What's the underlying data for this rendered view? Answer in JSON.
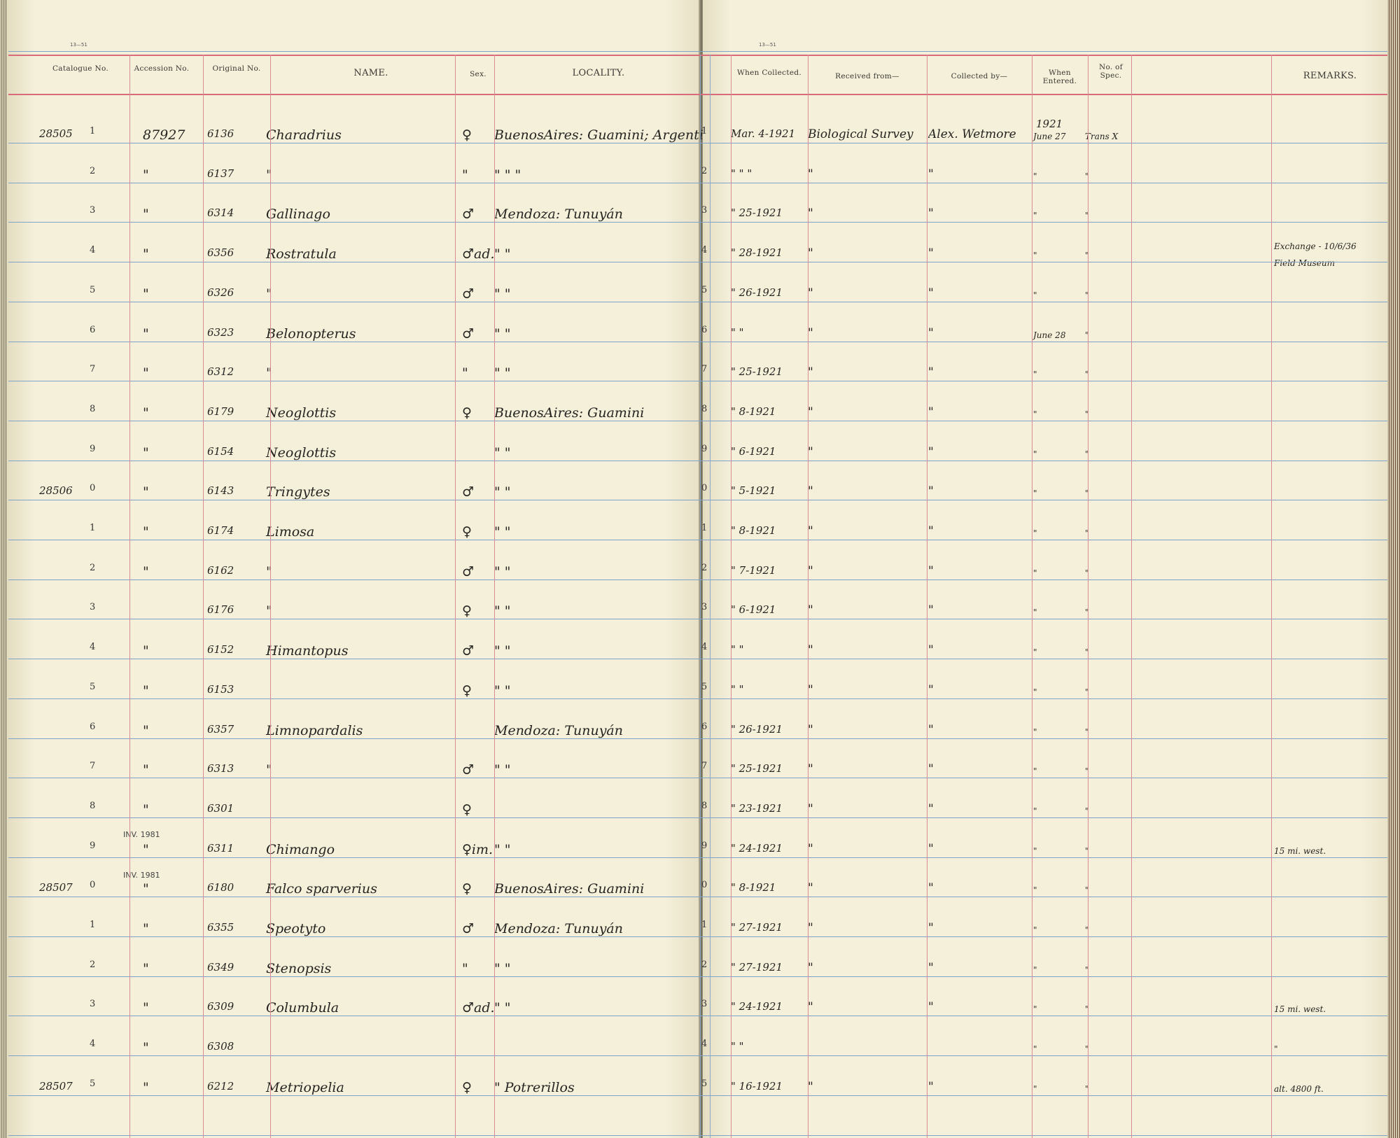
{
  "form_number": "13—51",
  "headers": {
    "catalogue_no": "Catalogue No.",
    "accession_no": "Accession No.",
    "original_no": "Original No.",
    "name": "NAME.",
    "sex": "Sex.",
    "locality": "LOCALITY.",
    "when_collected": "When Collected.",
    "received_from": "Received from—",
    "collected_by": "Collected by—",
    "when_entered": "When Entered.",
    "no_of_spec": "No. of Spec.",
    "remarks": "REMARKS."
  },
  "year_entered": "1921",
  "rows": [
    {
      "cat": "28505",
      "idx": "1",
      "acc": "87927",
      "orig": "6136",
      "name": "Charadrius",
      "sex": "♀",
      "loc": "BuenosAires: Guamini; Argentina",
      "when": "Mar. 4-1921",
      "recv": "Biological Survey",
      "coll": "Alex. Wetmore",
      "entered": "June 27",
      "spec": "Trans X",
      "remarks": ""
    },
    {
      "cat": "",
      "idx": "2",
      "acc": "\"",
      "orig": "6137",
      "name": "\"",
      "sex": "\"",
      "loc": "\"        \"        \"",
      "when": "\"   \"   \"",
      "recv": "\"",
      "coll": "\"",
      "entered": "\"",
      "spec": "\"",
      "remarks": ""
    },
    {
      "cat": "",
      "idx": "3",
      "acc": "\"",
      "orig": "6314",
      "name": "Gallinago",
      "sex": "♂",
      "loc": "Mendoza: Tunuyán",
      "when": "\" 25-1921",
      "recv": "\"",
      "coll": "\"",
      "entered": "\"",
      "spec": "\"",
      "remarks": ""
    },
    {
      "cat": "",
      "idx": "4",
      "acc": "\"",
      "orig": "6356",
      "name": "Rostratula",
      "sex": "♂ad.",
      "loc": "\"        \"",
      "when": "\" 28-1921",
      "recv": "\"",
      "coll": "\"",
      "entered": "\"",
      "spec": "\"",
      "remarks": "Exchange - 10/6/36 Field Museum"
    },
    {
      "cat": "",
      "idx": "5",
      "acc": "\"",
      "orig": "6326",
      "name": "\"",
      "sex": "♂",
      "loc": "\"        \"",
      "when": "\" 26-1921",
      "recv": "\"",
      "coll": "\"",
      "entered": "\"",
      "spec": "\"",
      "remarks": ""
    },
    {
      "cat": "",
      "idx": "6",
      "acc": "\"",
      "orig": "6323",
      "name": "Belonopterus",
      "sex": "♂",
      "loc": "\"        \"",
      "when": "\"   \"",
      "recv": "\"",
      "coll": "\"",
      "entered": "June 28",
      "spec": "\"",
      "remarks": ""
    },
    {
      "cat": "",
      "idx": "7",
      "acc": "\"",
      "orig": "6312",
      "name": "\"",
      "sex": "\"",
      "loc": "\"        \"",
      "when": "\" 25-1921",
      "recv": "\"",
      "coll": "\"",
      "entered": "\"",
      "spec": "\"",
      "remarks": ""
    },
    {
      "cat": "",
      "idx": "8",
      "acc": "\"",
      "orig": "6179",
      "name": "Neoglottis",
      "sex": "♀",
      "loc": "BuenosAires: Guamini",
      "when": "\" 8-1921",
      "recv": "\"",
      "coll": "\"",
      "entered": "\"",
      "spec": "\"",
      "remarks": ""
    },
    {
      "cat": "",
      "idx": "9",
      "acc": "\"",
      "orig": "6154",
      "name": "Neoglottis",
      "sex": "",
      "loc": "\"        \"",
      "when": "\" 6-1921",
      "recv": "\"",
      "coll": "\"",
      "entered": "\"",
      "spec": "\"",
      "remarks": ""
    },
    {
      "cat": "28506",
      "idx": "0",
      "acc": "\"",
      "orig": "6143",
      "name": "Tringytes",
      "sex": "♂",
      "loc": "\"        \"",
      "when": "\" 5-1921",
      "recv": "\"",
      "coll": "\"",
      "entered": "\"",
      "spec": "\"",
      "remarks": ""
    },
    {
      "cat": "",
      "idx": "1",
      "acc": "\"",
      "orig": "6174",
      "name": "Limosa",
      "sex": "♀",
      "loc": "\"        \"",
      "when": "\" 8-1921",
      "recv": "\"",
      "coll": "\"",
      "entered": "\"",
      "spec": "\"",
      "remarks": ""
    },
    {
      "cat": "",
      "idx": "2",
      "acc": "\"",
      "orig": "6162",
      "name": "\"",
      "sex": "♂",
      "loc": "\"        \"",
      "when": "\" 7-1921",
      "recv": "\"",
      "coll": "\"",
      "entered": "\"",
      "spec": "\"",
      "remarks": ""
    },
    {
      "cat": "",
      "idx": "3",
      "acc": "",
      "orig": "6176",
      "name": "\"",
      "sex": "♀",
      "loc": "\"        \"",
      "when": "\" 6-1921",
      "recv": "\"",
      "coll": "\"",
      "entered": "\"",
      "spec": "\"",
      "remarks": ""
    },
    {
      "cat": "",
      "idx": "4",
      "acc": "\"",
      "orig": "6152",
      "name": "Himantopus",
      "sex": "♂",
      "loc": "\"        \"",
      "when": "\"   \"",
      "recv": "\"",
      "coll": "\"",
      "entered": "\"",
      "spec": "\"",
      "remarks": ""
    },
    {
      "cat": "",
      "idx": "5",
      "acc": "\"",
      "orig": "6153",
      "name": "",
      "sex": "♀",
      "loc": "\"        \"",
      "when": "\"   \"",
      "recv": "\"",
      "coll": "\"",
      "entered": "\"",
      "spec": "\"",
      "remarks": ""
    },
    {
      "cat": "",
      "idx": "6",
      "acc": "\"",
      "orig": "6357",
      "name": "Limnopardalis",
      "sex": "",
      "loc": "Mendoza: Tunuyán",
      "when": "\" 26-1921",
      "recv": "\"",
      "coll": "\"",
      "entered": "\"",
      "spec": "\"",
      "remarks": ""
    },
    {
      "cat": "",
      "idx": "7",
      "acc": "\"",
      "orig": "6313",
      "name": "\"",
      "sex": "♂",
      "loc": "\"        \"",
      "when": "\" 25-1921",
      "recv": "\"",
      "coll": "\"",
      "entered": "\"",
      "spec": "\"",
      "remarks": ""
    },
    {
      "cat": "",
      "idx": "8",
      "acc": "\"",
      "orig": "6301",
      "name": "",
      "sex": "♀",
      "loc": "",
      "when": "\" 23-1921",
      "recv": "\"",
      "coll": "\"",
      "entered": "\"",
      "spec": "\"",
      "remarks": ""
    },
    {
      "cat": "",
      "idx": "9",
      "acc": "\"",
      "orig": "6311",
      "name": "Chimango",
      "sex": "♀im.",
      "loc": "\"        \"",
      "when": "\" 24-1921",
      "recv": "\"",
      "coll": "\"",
      "entered": "\"",
      "spec": "\"",
      "remarks": "15 mi. west."
    },
    {
      "cat": "28507",
      "idx": "0",
      "acc": "\"",
      "orig": "6180",
      "name": "Falco sparverius",
      "sex": "♀",
      "loc": "BuenosAires: Guamini",
      "when": "\" 8-1921",
      "recv": "\"",
      "coll": "\"",
      "entered": "\"",
      "spec": "\"",
      "remarks": ""
    },
    {
      "cat": "",
      "idx": "1",
      "acc": "\"",
      "orig": "6355",
      "name": "Speotyto",
      "sex": "♂",
      "loc": "Mendoza: Tunuyán",
      "when": "\" 27-1921",
      "recv": "\"",
      "coll": "\"",
      "entered": "\"",
      "spec": "\"",
      "remarks": ""
    },
    {
      "cat": "",
      "idx": "2",
      "acc": "\"",
      "orig": "6349",
      "name": "Stenopsis",
      "sex": "\"",
      "loc": "\"        \"",
      "when": "\" 27-1921",
      "recv": "\"",
      "coll": "\"",
      "entered": "\"",
      "spec": "\"",
      "remarks": ""
    },
    {
      "cat": "",
      "idx": "3",
      "acc": "\"",
      "orig": "6309",
      "name": "Columbula",
      "sex": "♂ad.",
      "loc": "\"        \"",
      "when": "\" 24-1921",
      "recv": "\"",
      "coll": "\"",
      "entered": "\"",
      "spec": "\"",
      "remarks": "15 mi. west."
    },
    {
      "cat": "",
      "idx": "4",
      "acc": "\"",
      "orig": "6308",
      "name": "",
      "sex": "",
      "loc": "",
      "when": "\"   \"",
      "recv": "",
      "coll": "",
      "entered": "\"",
      "spec": "\"",
      "remarks": "\""
    },
    {
      "cat": "28507",
      "idx": "5",
      "acc": "\"",
      "orig": "6212",
      "name": "Metriopelia",
      "sex": "♀",
      "loc": "\"   Potrerillos",
      "when": "\" 16-1921",
      "recv": "\"",
      "coll": "\"",
      "entered": "\"",
      "spec": "\"",
      "remarks": "alt. 4800 ft."
    }
  ],
  "stamps": [
    "INV. 1981",
    "INV. 1981"
  ]
}
